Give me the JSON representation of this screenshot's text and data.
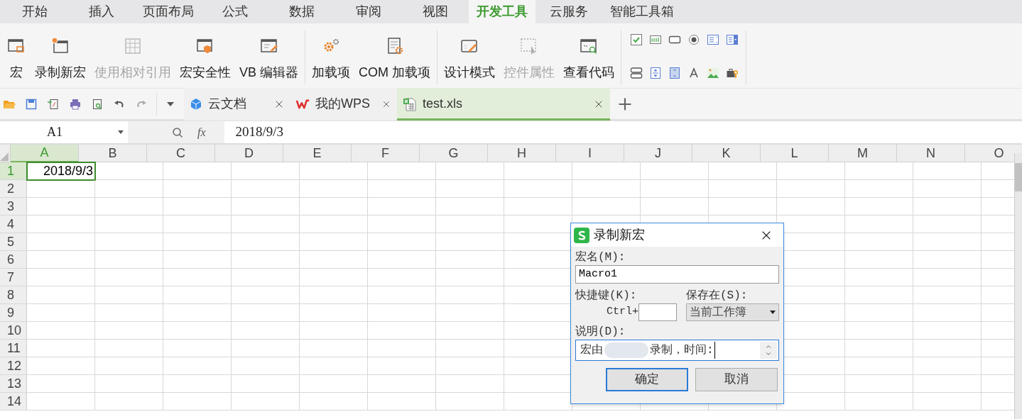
{
  "menu_tabs": [
    {
      "label": "开始",
      "selected": false
    },
    {
      "label": "插入",
      "selected": false
    },
    {
      "label": "页面布局",
      "selected": false
    },
    {
      "label": "公式",
      "selected": false
    },
    {
      "label": "数据",
      "selected": false
    },
    {
      "label": "审阅",
      "selected": false
    },
    {
      "label": "视图",
      "selected": false
    },
    {
      "label": "开发工具",
      "selected": true
    },
    {
      "label": "云服务",
      "selected": false
    },
    {
      "label": "智能工具箱",
      "selected": false
    }
  ],
  "ribbon_groups": [
    [
      {
        "label": "宏",
        "disabled": false
      },
      {
        "label": "录制新宏",
        "disabled": false
      },
      {
        "label": "使用相对引用",
        "disabled": true
      },
      {
        "label": "宏安全性",
        "disabled": false
      },
      {
        "label": "VB 编辑器",
        "disabled": false
      }
    ],
    [
      {
        "label": "加载项",
        "disabled": false
      },
      {
        "label": "COM 加载项",
        "disabled": false
      }
    ],
    [
      {
        "label": "设计模式",
        "disabled": false
      },
      {
        "label": "控件属性",
        "disabled": true
      },
      {
        "label": "查看代码",
        "disabled": false
      }
    ]
  ],
  "doc_tabs": [
    {
      "label": "云文档",
      "selected": false
    },
    {
      "label": "我的WPS",
      "selected": false
    },
    {
      "label": "test.xls",
      "selected": true
    }
  ],
  "formula_bar": {
    "name_box": "A1",
    "fx_label": "fx",
    "value": "2018/9/3"
  },
  "sheet": {
    "columns": [
      {
        "label": "A",
        "selected": true
      },
      {
        "label": "B",
        "selected": false
      },
      {
        "label": "C",
        "selected": false
      },
      {
        "label": "D",
        "selected": false
      },
      {
        "label": "E",
        "selected": false
      },
      {
        "label": "F",
        "selected": false
      },
      {
        "label": "G",
        "selected": false
      },
      {
        "label": "H",
        "selected": false
      },
      {
        "label": "I",
        "selected": false
      },
      {
        "label": "J",
        "selected": false
      },
      {
        "label": "K",
        "selected": false
      },
      {
        "label": "L",
        "selected": false
      },
      {
        "label": "M",
        "selected": false
      },
      {
        "label": "N",
        "selected": false
      },
      {
        "label": "O",
        "selected": false
      }
    ],
    "rows": [
      {
        "label": "1",
        "selected": true,
        "cells": [
          {
            "value": "2018/9/3",
            "selected": true
          }
        ]
      },
      {
        "label": "2",
        "selected": false
      },
      {
        "label": "3",
        "selected": false
      },
      {
        "label": "4",
        "selected": false
      },
      {
        "label": "5",
        "selected": false
      },
      {
        "label": "6",
        "selected": false
      },
      {
        "label": "7",
        "selected": false
      },
      {
        "label": "8",
        "selected": false
      },
      {
        "label": "9",
        "selected": false
      },
      {
        "label": "10",
        "selected": false
      },
      {
        "label": "11",
        "selected": false
      },
      {
        "label": "12",
        "selected": false
      },
      {
        "label": "13",
        "selected": false
      },
      {
        "label": "14",
        "selected": false
      }
    ]
  },
  "dialog": {
    "title": "录制新宏",
    "macro_name_label": "宏名(M):",
    "macro_name": "Macro1",
    "shortcut_label": "快捷键(K):",
    "shortcut_prefix": "Ctrl+",
    "save_in_label": "保存在(S):",
    "save_in": "当前工作簿",
    "description_label": "说明(D):",
    "description_before_blur": "宏由",
    "description_after_blur": "录制，时间:",
    "buttons": [
      {
        "label": "确定",
        "default": true
      },
      {
        "label": "取消",
        "default": false
      }
    ]
  }
}
